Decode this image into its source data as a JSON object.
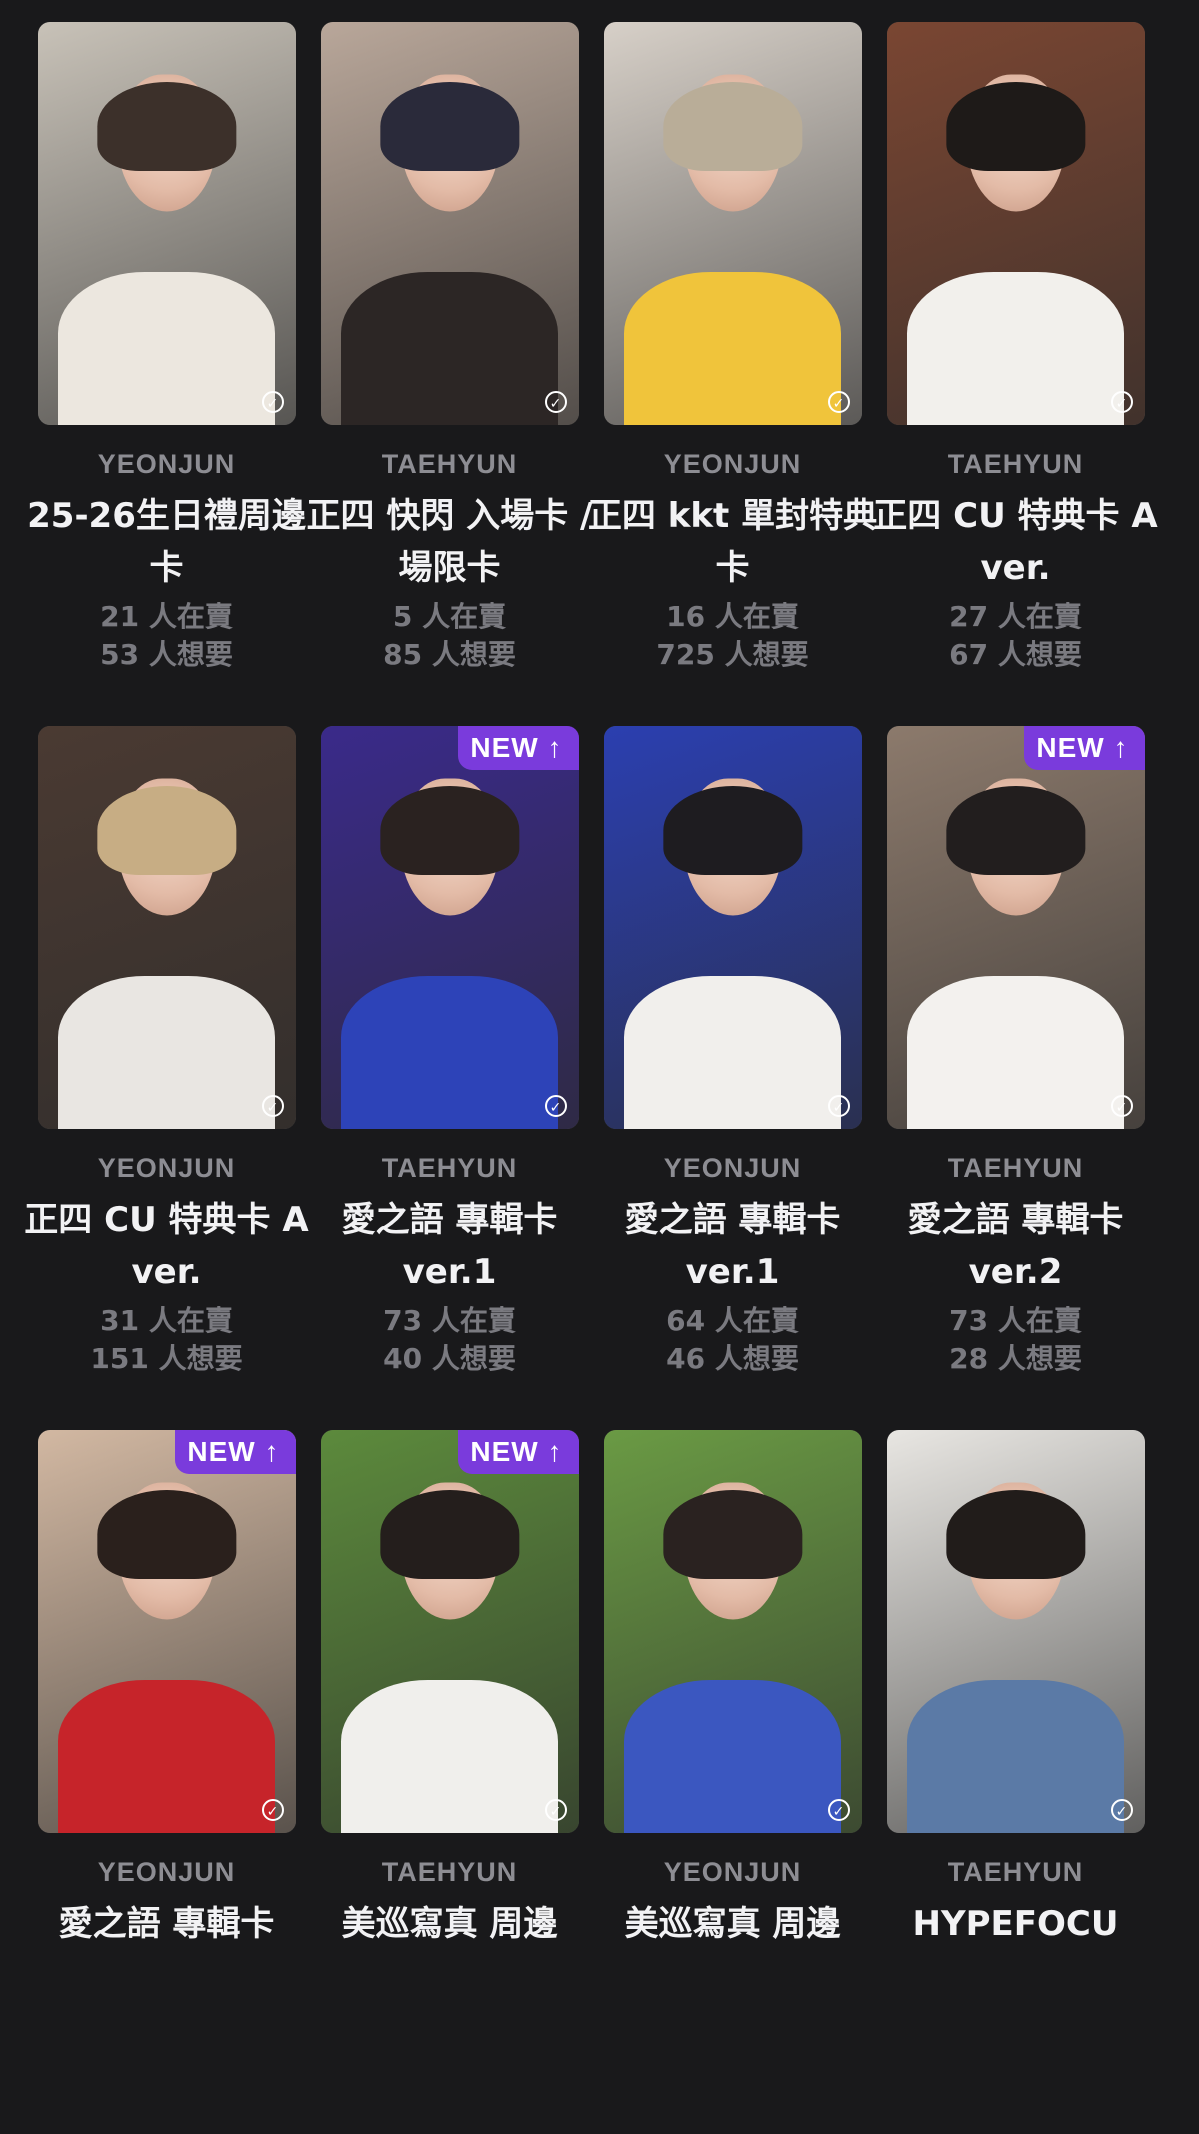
{
  "cards": [
    {
      "artist": "YEONJUN",
      "title": "25-26生日禮周邊卡",
      "selling": "21 人在賣",
      "wanting": "53 人想要",
      "new": false,
      "colors": {
        "bg": "#c8c2b8",
        "hair": "#3c302a",
        "shirt": "#ece7df"
      }
    },
    {
      "artist": "TAEHYUN",
      "title": "正四 快閃 入場卡 / 場限卡",
      "selling": "5 人在賣",
      "wanting": "85 人想要",
      "new": false,
      "colors": {
        "bg": "#b9a79a",
        "hair": "#2a2a3a",
        "shirt": "#2c2625"
      }
    },
    {
      "artist": "YEONJUN",
      "title": "正四 kkt 單封特典卡",
      "selling": "16 人在賣",
      "wanting": "725 人想要",
      "new": false,
      "colors": {
        "bg": "#d7d0c8",
        "hair": "#b9ad98",
        "shirt": "#f0c43b"
      }
    },
    {
      "artist": "TAEHYUN",
      "title": "正四 CU 特典卡 A ver.",
      "selling": "27 人在賣",
      "wanting": "67 人想要",
      "new": false,
      "colors": {
        "bg": "#7a4632",
        "hair": "#1e1a18",
        "shirt": "#f2f0ec"
      }
    },
    {
      "artist": "YEONJUN",
      "title": "正四 CU 特典卡 A ver.",
      "selling": "31 人在賣",
      "wanting": "151 人想要",
      "new": false,
      "colors": {
        "bg": "#4a3a32",
        "hair": "#c7ad84",
        "shirt": "#e9e6e2"
      }
    },
    {
      "artist": "TAEHYUN",
      "title": "愛之語 專輯卡 ver.1",
      "selling": "73 人在賣",
      "wanting": "40 人想要",
      "new": true,
      "colors": {
        "bg": "#3a2a8a",
        "hair": "#2a2220",
        "shirt": "#2d43b8"
      }
    },
    {
      "artist": "YEONJUN",
      "title": "愛之語 專輯卡 ver.1",
      "selling": "64 人在賣",
      "wanting": "46 人想要",
      "new": false,
      "colors": {
        "bg": "#2b3fb0",
        "hair": "#1e1c20",
        "shirt": "#f1efec"
      }
    },
    {
      "artist": "TAEHYUN",
      "title": "愛之語 專輯卡 ver.2",
      "selling": "73 人在賣",
      "wanting": "28 人想要",
      "new": true,
      "colors": {
        "bg": "#8c7a6c",
        "hair": "#221e1e",
        "shirt": "#f3f1ee"
      }
    },
    {
      "artist": "YEONJUN",
      "title": "愛之語 專輯卡",
      "selling": "",
      "wanting": "",
      "new": true,
      "colors": {
        "bg": "#d2b8a2",
        "hair": "#2a201c",
        "shirt": "#c6242a"
      }
    },
    {
      "artist": "TAEHYUN",
      "title": "美巡寫真 周邊",
      "selling": "",
      "wanting": "",
      "new": true,
      "colors": {
        "bg": "#5c8a3c",
        "hair": "#241e1c",
        "shirt": "#f0efec"
      }
    },
    {
      "artist": "YEONJUN",
      "title": "美巡寫真 周邊",
      "selling": "",
      "wanting": "",
      "new": false,
      "colors": {
        "bg": "#6a9a44",
        "hair": "#2a2220",
        "shirt": "#3b57c0"
      }
    },
    {
      "artist": "TAEHYUN",
      "title": "HYPEFOCU",
      "selling": "",
      "wanting": "",
      "new": false,
      "colors": {
        "bg": "#e8e6e2",
        "hair": "#211c1a",
        "shirt": "#5b7aa6"
      }
    }
  ],
  "badge_label": "NEW ↑",
  "check_glyph": "✓"
}
